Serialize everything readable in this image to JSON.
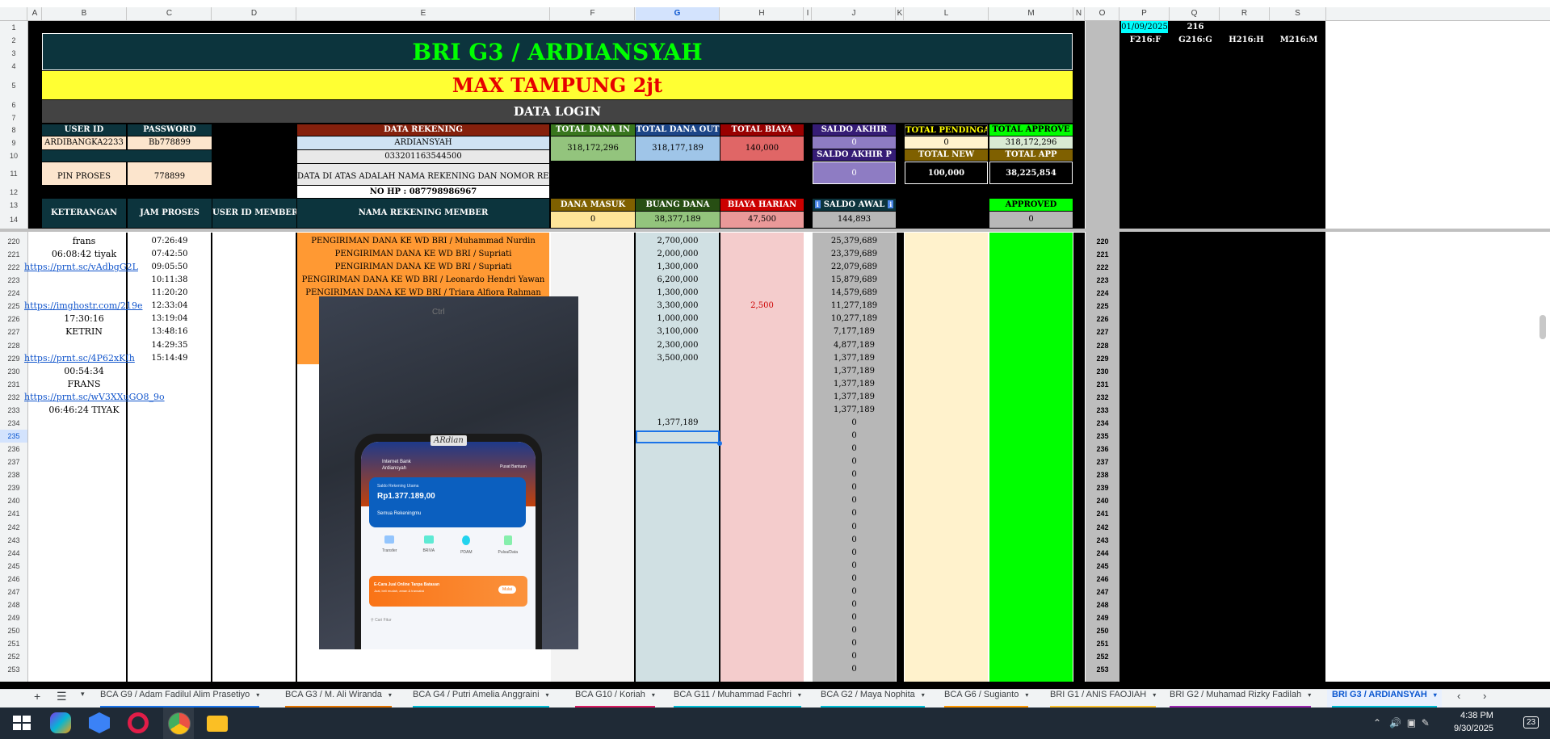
{
  "columns": [
    "A",
    "B",
    "C",
    "D",
    "E",
    "F",
    "G",
    "H",
    "I",
    "J",
    "K",
    "L",
    "M",
    "N",
    "O",
    "P",
    "Q",
    "R",
    "S"
  ],
  "header": {
    "title": "BRI G3 / ARDIANSYAH",
    "max": "MAX TAMPUNG 2jt",
    "data_login": "DATA LOGIN"
  },
  "login": {
    "user_id_label": "USER ID",
    "password_label": "PASSWORD",
    "user_id": "ARDIBANGKA2233",
    "password": "Bb778899",
    "pin_label": "PIN PROSES",
    "pin": "778899"
  },
  "rekening": {
    "label": "DATA REKENING",
    "name": "ARDIANSYAH",
    "number": "033201163544500",
    "note": "DATA DI ATAS ADALAH NAMA REKENING DAN NOMOR REKENING",
    "hp": "NO HP : 087798986967"
  },
  "totals": {
    "dana_in_label": "TOTAL DANA IN",
    "dana_in": "318,172,296",
    "dana_out_label": "TOTAL DANA OUT",
    "dana_out": "318,177,189",
    "biaya_label": "TOTAL BIAYA",
    "biaya": "140,000",
    "saldo_akhir_label": "SALDO AKHIR",
    "saldo_akhir": "0",
    "saldo_akhir_p_label": "SALDO AKHIR P",
    "saldo_akhir_p": "0",
    "pending_label": "TOTAL PENDINGAN",
    "pending": "0",
    "approve_label": "TOTAL APPROVE",
    "approve": "318,172,296",
    "new_label": "TOTAL NEW",
    "new": "100,000",
    "app_label": "TOTAL APP",
    "app": "38,225,854"
  },
  "table_headers": {
    "keterangan": "KETERANGAN",
    "jam": "JAM PROSES",
    "user_member": "USER ID MEMBER",
    "nama_rek": "NAMA REKENING MEMBER",
    "dana_masuk": "DANA MASUK",
    "buang_dana": "BUANG DANA",
    "biaya_harian": "BIAYA HARIAN",
    "saldo_awal": "SALDO AWAL",
    "approved": "APPROVED"
  },
  "subtotals": {
    "dana_masuk": "0",
    "buang_dana": "38,377,189",
    "biaya_harian": "47,500",
    "saldo_awal": "144,893",
    "approved": "0"
  },
  "side": {
    "date": "01/09/2025",
    "num": "216",
    "refs": [
      "F216:F",
      "G216:G",
      "H216:H",
      "M216:M"
    ]
  },
  "top_row_numbers": [
    "1",
    "2",
    "3",
    "4",
    "5",
    "6",
    "7",
    "8",
    "9",
    "10",
    "11",
    "12",
    "13",
    "14"
  ],
  "rows": [
    {
      "n": "220",
      "ket": "frans",
      "jam": "07:26:49",
      "nama": "PENGIRIMAN DANA KE WD BRI / Muhammad Nurdin",
      "buang": "2,700,000",
      "biaya": "",
      "saldo": "25,379,689"
    },
    {
      "n": "221",
      "ket": "06:08:42 tiyak",
      "jam": "07:42:50",
      "nama": "PENGIRIMAN DANA KE WD BRI / Supriati",
      "buang": "2,000,000",
      "biaya": "",
      "saldo": "23,379,689"
    },
    {
      "n": "222",
      "ket": "https://prnt.sc/vAdbgG2L",
      "jam": "09:05:50",
      "nama": "PENGIRIMAN DANA KE WD BRI / Supriati",
      "buang": "1,300,000",
      "biaya": "",
      "saldo": "22,079,689"
    },
    {
      "n": "223",
      "ket": "",
      "jam": "10:11:38",
      "nama": "PENGIRIMAN DANA KE WD BRI / Leonardo Hendri Yawan",
      "buang": "6,200,000",
      "biaya": "",
      "saldo": "15,879,689"
    },
    {
      "n": "224",
      "ket": "",
      "jam": "11:20:20",
      "nama": "PENGIRIMAN DANA KE WD BRI / Triara Alfiora Rahman",
      "buang": "1,300,000",
      "biaya": "",
      "saldo": "14,579,689"
    },
    {
      "n": "225",
      "ket": "https://imghostr.com/219e",
      "jam": "12:33:04",
      "nama": "",
      "buang": "3,300,000",
      "biaya": "2,500",
      "saldo": "11,277,189"
    },
    {
      "n": "226",
      "ket": "17:30:16",
      "jam": "13:19:04",
      "nama": "",
      "buang": "1,000,000",
      "biaya": "",
      "saldo": "10,277,189"
    },
    {
      "n": "227",
      "ket": "KETRIN",
      "jam": "13:48:16",
      "nama": "",
      "buang": "3,100,000",
      "biaya": "",
      "saldo": "7,177,189"
    },
    {
      "n": "228",
      "ket": "",
      "jam": "14:29:35",
      "nama": "",
      "buang": "2,300,000",
      "biaya": "",
      "saldo": "4,877,189"
    },
    {
      "n": "229",
      "ket": "https://prnt.sc/4P62xKIh",
      "jam": "15:14:49",
      "nama": "",
      "buang": "3,500,000",
      "biaya": "",
      "saldo": "1,377,189"
    },
    {
      "n": "230",
      "ket": "00:54:34",
      "jam": "",
      "nama": "",
      "buang": "",
      "biaya": "",
      "saldo": "1,377,189"
    },
    {
      "n": "231",
      "ket": "FRANS",
      "jam": "",
      "nama": "",
      "buang": "",
      "biaya": "",
      "saldo": "1,377,189"
    },
    {
      "n": "232",
      "ket": "https://prnt.sc/wV3XXuGO8_9o",
      "jam": "",
      "nama": "",
      "buang": "",
      "biaya": "",
      "saldo": "1,377,189"
    },
    {
      "n": "233",
      "ket": "06:46:24 TIYAK",
      "jam": "",
      "nama": "",
      "buang": "",
      "biaya": "",
      "saldo": "1,377,189"
    },
    {
      "n": "234",
      "ket": "",
      "jam": "",
      "nama": "",
      "buang": "1,377,189",
      "biaya": "",
      "saldo": "0"
    },
    {
      "n": "235",
      "ket": "",
      "jam": "",
      "nama": "",
      "buang": "",
      "biaya": "",
      "saldo": "0"
    },
    {
      "n": "236",
      "ket": "",
      "jam": "",
      "nama": "",
      "buang": "",
      "biaya": "",
      "saldo": "0"
    },
    {
      "n": "237",
      "ket": "",
      "jam": "",
      "nama": "",
      "buang": "",
      "biaya": "",
      "saldo": "0"
    },
    {
      "n": "238",
      "ket": "",
      "jam": "",
      "nama": "",
      "buang": "",
      "biaya": "",
      "saldo": "0"
    },
    {
      "n": "239",
      "ket": "",
      "jam": "",
      "nama": "",
      "buang": "",
      "biaya": "",
      "saldo": "0"
    },
    {
      "n": "240",
      "ket": "",
      "jam": "",
      "nama": "",
      "buang": "",
      "biaya": "",
      "saldo": "0"
    },
    {
      "n": "241",
      "ket": "",
      "jam": "",
      "nama": "",
      "buang": "",
      "biaya": "",
      "saldo": "0"
    },
    {
      "n": "242",
      "ket": "",
      "jam": "",
      "nama": "",
      "buang": "",
      "biaya": "",
      "saldo": "0"
    },
    {
      "n": "243",
      "ket": "",
      "jam": "",
      "nama": "",
      "buang": "",
      "biaya": "",
      "saldo": "0"
    },
    {
      "n": "244",
      "ket": "",
      "jam": "",
      "nama": "",
      "buang": "",
      "biaya": "",
      "saldo": "0"
    },
    {
      "n": "245",
      "ket": "",
      "jam": "",
      "nama": "",
      "buang": "",
      "biaya": "",
      "saldo": "0"
    },
    {
      "n": "246",
      "ket": "",
      "jam": "",
      "nama": "",
      "buang": "",
      "biaya": "",
      "saldo": "0"
    },
    {
      "n": "247",
      "ket": "",
      "jam": "",
      "nama": "",
      "buang": "",
      "biaya": "",
      "saldo": "0"
    },
    {
      "n": "248",
      "ket": "",
      "jam": "",
      "nama": "",
      "buang": "",
      "biaya": "",
      "saldo": "0"
    },
    {
      "n": "249",
      "ket": "",
      "jam": "",
      "nama": "",
      "buang": "",
      "biaya": "",
      "saldo": "0"
    },
    {
      "n": "250",
      "ket": "",
      "jam": "",
      "nama": "",
      "buang": "",
      "biaya": "",
      "saldo": "0"
    },
    {
      "n": "251",
      "ket": "",
      "jam": "",
      "nama": "",
      "buang": "",
      "biaya": "",
      "saldo": "0"
    },
    {
      "n": "252",
      "ket": "",
      "jam": "",
      "nama": "",
      "buang": "",
      "biaya": "",
      "saldo": "0"
    },
    {
      "n": "253",
      "ket": "",
      "jam": "",
      "nama": "",
      "buang": "",
      "biaya": "",
      "saldo": "0"
    }
  ],
  "photo": {
    "key_label": "Ctrl",
    "sticker": "ARdian",
    "bank_user": "Ardiansyah",
    "bank_greeting": "Internet Bank",
    "saldo_label": "Saldo Rekening Utama",
    "saldo": "Rp1.377.189,00",
    "semua": "Semua Rekeningmu",
    "menu": [
      "Transfer",
      "BRIVA",
      "PDAM",
      "Pulsa/Data"
    ],
    "promo_title": "E-Cara Jual Online Tanpa Batasan",
    "promo_sub": "Jual, beli mudah, aman & transaksi",
    "promo_btn": "Mulai",
    "search": "Cari Fitur",
    "pusat": "Pusat Bantuan"
  },
  "tabs": [
    {
      "label": "BCA G9 / Adam Fadilul Alim Prasetiyo",
      "color": "#1a73e8"
    },
    {
      "label": "BCA G3 / M. Ali Wiranda",
      "color": "#e37400"
    },
    {
      "label": "BCA G4 / Putri Amelia Anggraini",
      "color": "#00bcd4"
    },
    {
      "label": "BCA G10 / Koriah",
      "color": "#d81b60"
    },
    {
      "label": "BCA G11 / Muhammad Fachri",
      "color": "#00bcd4"
    },
    {
      "label": "BCA G2 / Maya Nophita",
      "color": "#00bcd4"
    },
    {
      "label": "BCA G6 / Sugianto",
      "color": "#ff9800"
    },
    {
      "label": "BRI G1 / ANIS FAOJIAH",
      "color": "#fbc02d"
    },
    {
      "label": "BRI G2 / Muhamad Rizky Fadilah",
      "color": "#9c27b0"
    },
    {
      "label": "BRI G3 / ARDIANSYAH",
      "color": "#00bcd4"
    }
  ],
  "clock": {
    "time": "4:38 PM",
    "date": "9/30/2025",
    "badge": "23"
  }
}
